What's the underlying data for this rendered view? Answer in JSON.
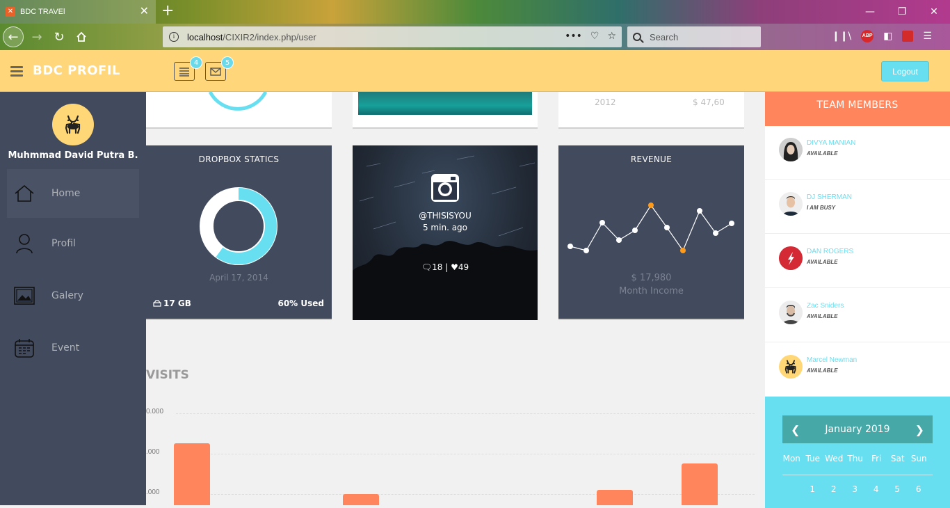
{
  "browser": {
    "tab_title": "BDC TRAVEl",
    "tab_icon": "xampp-icon",
    "url_host": "localhost",
    "url_path": "/CIXIR2/index.php/user",
    "search_placeholder": "Search"
  },
  "header": {
    "title": "BDC PROFIL",
    "tasks_badge": "4",
    "mail_badge": "5",
    "logout_label": "Logout",
    "accent": "#ffd67a"
  },
  "sidebar": {
    "profile_name": "Muhmmad David Putra B.",
    "items": [
      {
        "label": "Home",
        "icon": "home-icon",
        "active": true
      },
      {
        "label": "Profil",
        "icon": "user-icon",
        "active": false
      },
      {
        "label": "Galery",
        "icon": "gallery-icon",
        "active": false
      },
      {
        "label": "Event",
        "icon": "calendar-icon",
        "active": false
      }
    ]
  },
  "top_cards": {
    "stat_year": "2012",
    "stat_amount": "$ 47,60"
  },
  "dropbox": {
    "title": "DROPBOX STATICS",
    "date": "April 17, 2014",
    "size": "17 GB",
    "used": "60% Used",
    "used_fraction": 0.6
  },
  "instagram": {
    "handle": "@THISISYOU",
    "time": "5 min. ago",
    "comments": "18",
    "likes": "49"
  },
  "revenue": {
    "title": "REVENUE",
    "amount": "$ 17,980",
    "caption": "Month Income"
  },
  "visits": {
    "title": "VISITS",
    "y_labels": [
      "0.000",
      ".000",
      ".000"
    ]
  },
  "team": {
    "title": "TEAM MEMBERS",
    "members": [
      {
        "name": "DIVYA MANIAN",
        "status": "AVAILABLE"
      },
      {
        "name": "DJ SHERMAN",
        "status": "I AM BUSY"
      },
      {
        "name": "DAN ROGERS",
        "status": "AVAILABLE"
      },
      {
        "name": "Zac Sniders",
        "status": "AVAILABLE"
      },
      {
        "name": "Marcel Newman",
        "status": "AVAILABLE"
      }
    ]
  },
  "calendar": {
    "month": "January 2019",
    "days": [
      "Mon",
      "Tue",
      "Wed",
      "Thu",
      "Fri",
      "Sat",
      "Sun"
    ],
    "dates": [
      "1",
      "2",
      "3",
      "4",
      "5",
      "6"
    ]
  }
}
